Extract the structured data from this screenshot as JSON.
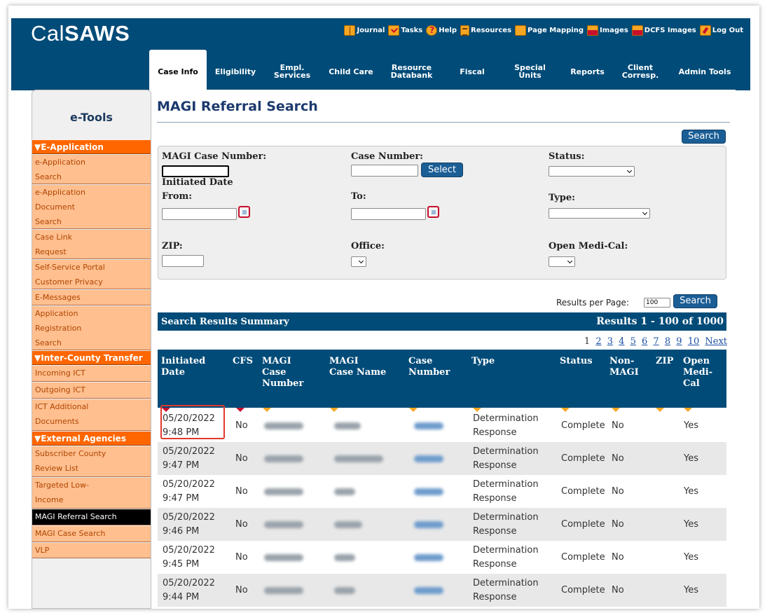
{
  "app": {
    "logo_prefix": "Cal",
    "logo_suffix": "SAWS"
  },
  "toolbar": [
    {
      "label": "Journal",
      "icon": "journal-icon"
    },
    {
      "label": "Tasks",
      "icon": "tasks-icon"
    },
    {
      "label": "Help",
      "icon": "help-icon"
    },
    {
      "label": "Resources",
      "icon": "resources-icon"
    },
    {
      "label": "Page Mapping",
      "icon": "page-mapping-icon"
    },
    {
      "label": "Images",
      "icon": "images-icon"
    },
    {
      "label": "DCFS Images",
      "icon": "dcfs-images-icon"
    },
    {
      "label": "Log Out",
      "icon": "logout-icon"
    }
  ],
  "nav": [
    {
      "line1": "Case Info",
      "line2": ""
    },
    {
      "line1": "Eligibility",
      "line2": ""
    },
    {
      "line1": "Empl.",
      "line2": "Services"
    },
    {
      "line1": "Child Care",
      "line2": ""
    },
    {
      "line1": "Resource",
      "line2": "Databank"
    },
    {
      "line1": "Fiscal",
      "line2": ""
    },
    {
      "line1": "Special",
      "line2": "Units"
    },
    {
      "line1": "Reports",
      "line2": ""
    },
    {
      "line1": "Client",
      "line2": "Corresp."
    },
    {
      "line1": "Admin Tools",
      "line2": ""
    }
  ],
  "sidebar": {
    "title": "e-Tools",
    "categories": [
      "▼E-Application",
      "▼Inter-County Transfer",
      "▼External Agencies"
    ],
    "items": [
      {
        "l1": "e-Application",
        "l2": "Search",
        "l3": ""
      },
      {
        "l1": "e-Application",
        "l2": "Document",
        "l3": "Search"
      },
      {
        "l1": "Case Link",
        "l2": "Request",
        "l3": ""
      },
      {
        "l1": "Self-Service Portal",
        "l2": "Customer Privacy",
        "l3": ""
      },
      {
        "l1": "E-Messages",
        "l2": "",
        "l3": ""
      },
      {
        "l1": "Application",
        "l2": "Registration",
        "l3": "Search"
      },
      {
        "l1": "Incoming ICT",
        "l2": "",
        "l3": ""
      },
      {
        "l1": "Outgoing ICT",
        "l2": "",
        "l3": ""
      },
      {
        "l1": "ICT Additional",
        "l2": "Documents",
        "l3": ""
      },
      {
        "l1": "Subscriber County",
        "l2": "Review List",
        "l3": ""
      },
      {
        "l1": "Targeted Low-",
        "l2": "Income",
        "l3": ""
      },
      {
        "l1": "MAGI Referral Search",
        "l2": "",
        "l3": ""
      },
      {
        "l1": "MAGI Case Search",
        "l2": "",
        "l3": ""
      },
      {
        "l1": "VLP",
        "l2": "",
        "l3": ""
      }
    ]
  },
  "page": {
    "title": "MAGI Referral Search",
    "search_label": "Search",
    "select_label": "Select"
  },
  "form": {
    "magi_case_number": "MAGI Case Number:",
    "case_number": "Case Number:",
    "status": "Status:",
    "initiated_date": "Initiated Date",
    "from": "From:",
    "to": "To:",
    "type": "Type:",
    "zip": "ZIP:",
    "office": "Office:",
    "open_medi_cal": "Open Medi-Cal:"
  },
  "results": {
    "per_page_label": "Results per Page:",
    "per_page_value": "100",
    "summary_title": "Search Results Summary",
    "summary_count": "Results 1 - 100 of 1000",
    "pages": [
      "1",
      "2",
      "3",
      "4",
      "5",
      "6",
      "7",
      "8",
      "9",
      "10",
      "Next"
    ]
  },
  "table": {
    "headers": [
      {
        "l1": "Initiated",
        "l2": "Date",
        "l3": ""
      },
      {
        "l1": "CFS",
        "l2": "",
        "l3": ""
      },
      {
        "l1": "MAGI",
        "l2": "Case",
        "l3": "Number"
      },
      {
        "l1": "MAGI",
        "l2": "Case Name",
        "l3": ""
      },
      {
        "l1": "Case",
        "l2": "Number",
        "l3": ""
      },
      {
        "l1": "Type",
        "l2": "",
        "l3": ""
      },
      {
        "l1": "Status",
        "l2": "",
        "l3": ""
      },
      {
        "l1": "Non-",
        "l2": "MAGI",
        "l3": ""
      },
      {
        "l1": "ZIP",
        "l2": "",
        "l3": ""
      },
      {
        "l1": "Open",
        "l2": "Medi-",
        "l3": "Cal"
      }
    ],
    "rows": [
      {
        "date": "05/20/2022",
        "time": "9:48 PM",
        "cfs": "No",
        "type1": "Determination",
        "type2": "Response",
        "status": "Complete",
        "non_magi": "No",
        "open": "Yes"
      },
      {
        "date": "05/20/2022",
        "time": "9:47 PM",
        "cfs": "No",
        "type1": "Determination",
        "type2": "Response",
        "status": "Complete",
        "non_magi": "No",
        "open": "Yes"
      },
      {
        "date": "05/20/2022",
        "time": "9:47 PM",
        "cfs": "No",
        "type1": "Determination",
        "type2": "Response",
        "status": "Complete",
        "non_magi": "No",
        "open": "Yes"
      },
      {
        "date": "05/20/2022",
        "time": "9:46 PM",
        "cfs": "No",
        "type1": "Determination",
        "type2": "Response",
        "status": "Complete",
        "non_magi": "No",
        "open": "Yes"
      },
      {
        "date": "05/20/2022",
        "time": "9:45 PM",
        "cfs": "No",
        "type1": "Determination",
        "type2": "Response",
        "status": "Complete",
        "non_magi": "No",
        "open": "Yes"
      },
      {
        "date": "05/20/2022",
        "time": "9:44 PM",
        "cfs": "No",
        "type1": "Determination",
        "type2": "Response",
        "status": "Complete",
        "non_magi": "No",
        "open": "Yes"
      }
    ]
  }
}
